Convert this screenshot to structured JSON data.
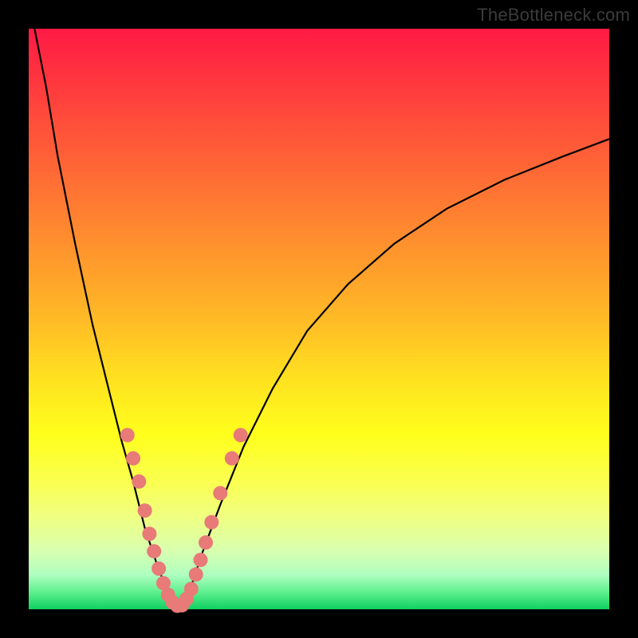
{
  "watermark": "TheBottleneck.com",
  "colors": {
    "background_frame": "#000000",
    "curve_stroke": "#000000",
    "marker_fill": "#e87a78",
    "marker_stroke": "#d86060"
  },
  "chart_data": {
    "type": "line",
    "title": "",
    "xlabel": "",
    "ylabel": "",
    "xlim": [
      0,
      100
    ],
    "ylim": [
      0,
      100
    ],
    "grid": false,
    "legend": false,
    "notes": "V-shaped bottleneck curve over a rainbow gradient. No axis ticks or numeric labels are visible; values below are approximate traced coordinates in 0–100 space with origin at bottom-left.",
    "series": [
      {
        "name": "left-arm",
        "x": [
          1,
          3,
          5,
          8,
          11,
          14,
          16,
          18,
          20,
          22,
          23.5,
          25
        ],
        "y": [
          100,
          90,
          78,
          63,
          49,
          37,
          29,
          22,
          14,
          8,
          4,
          0.5
        ]
      },
      {
        "name": "right-arm",
        "x": [
          26.5,
          28,
          30,
          33,
          37,
          42,
          48,
          55,
          63,
          72,
          82,
          92,
          100
        ],
        "y": [
          0.5,
          4,
          10,
          18,
          28,
          38,
          48,
          56,
          63,
          69,
          74,
          78,
          81
        ]
      }
    ],
    "markers": {
      "name": "highlight-dots",
      "points": [
        {
          "x": 17,
          "y": 30
        },
        {
          "x": 18,
          "y": 26
        },
        {
          "x": 19,
          "y": 22
        },
        {
          "x": 20,
          "y": 17
        },
        {
          "x": 20.8,
          "y": 13
        },
        {
          "x": 21.6,
          "y": 10
        },
        {
          "x": 22.4,
          "y": 7
        },
        {
          "x": 23.2,
          "y": 4.5
        },
        {
          "x": 24,
          "y": 2.5
        },
        {
          "x": 24.8,
          "y": 1.2
        },
        {
          "x": 25.6,
          "y": 0.6
        },
        {
          "x": 26.4,
          "y": 0.7
        },
        {
          "x": 27.2,
          "y": 1.8
        },
        {
          "x": 28,
          "y": 3.5
        },
        {
          "x": 28.8,
          "y": 6
        },
        {
          "x": 29.6,
          "y": 8.5
        },
        {
          "x": 30.5,
          "y": 11.5
        },
        {
          "x": 31.5,
          "y": 15
        },
        {
          "x": 33,
          "y": 20
        },
        {
          "x": 35,
          "y": 26
        },
        {
          "x": 36.5,
          "y": 30
        }
      ],
      "radius": 9
    }
  }
}
